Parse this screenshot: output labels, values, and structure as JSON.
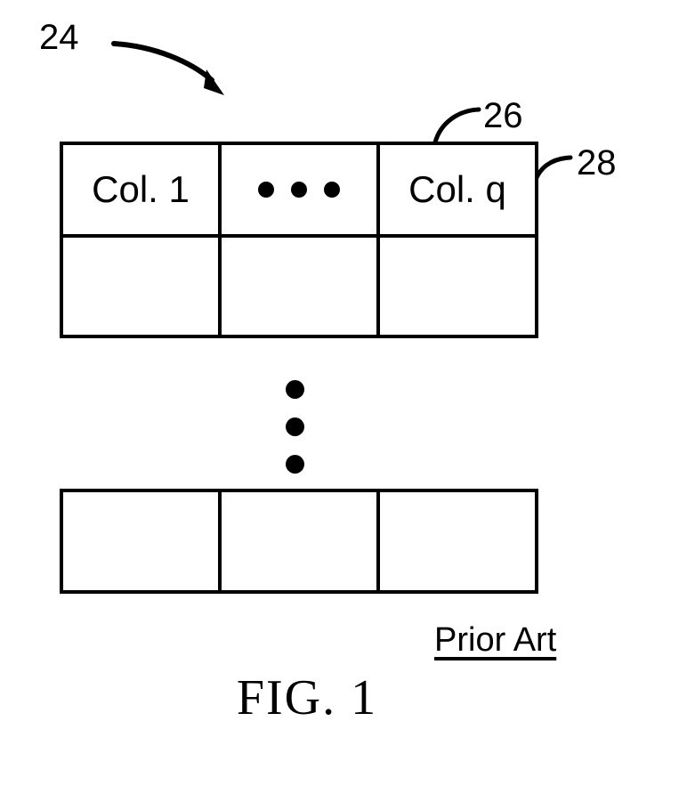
{
  "figure": {
    "caption": "FIG. 1",
    "annotation": "Prior Art",
    "background_color": "#ffffff",
    "line_color": "#000000"
  },
  "reference_numerals": [
    {
      "id": "24",
      "label": "24",
      "points_to": "table-assembly"
    },
    {
      "id": "26",
      "label": "26",
      "points_to": "table-top-edge"
    },
    {
      "id": "28",
      "label": "28",
      "points_to": "table-right-edge"
    }
  ],
  "upper_table": {
    "header_row": {
      "cells": [
        {
          "kind": "text",
          "label": "Col. 1"
        },
        {
          "kind": "ellipsis",
          "label": "",
          "dot_count": 3
        },
        {
          "kind": "text",
          "label": "Col. q"
        }
      ]
    },
    "body_row": {
      "cells": [
        {
          "kind": "empty",
          "label": ""
        },
        {
          "kind": "empty",
          "label": ""
        },
        {
          "kind": "empty",
          "label": ""
        }
      ]
    }
  },
  "row_ellipsis": {
    "orientation": "vertical",
    "dot_count": 3
  },
  "lower_table": {
    "body_row": {
      "cells": [
        {
          "kind": "empty",
          "label": ""
        },
        {
          "kind": "empty",
          "label": ""
        },
        {
          "kind": "empty",
          "label": ""
        }
      ]
    }
  }
}
